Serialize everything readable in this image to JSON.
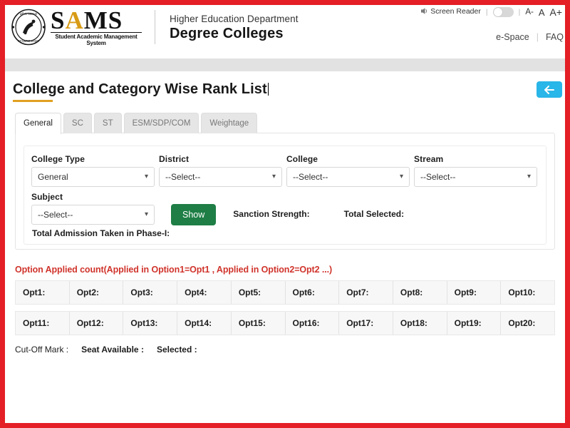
{
  "header": {
    "brand_name": "SAMS",
    "brand_letter_a": "A",
    "brand_subtitle": "Student Academic Management System",
    "dept_small": "Higher Education Department",
    "dept_big": "Degree Colleges",
    "utility": {
      "screen_reader_label": "Screen Reader",
      "font_decrease": "A-",
      "font_normal": "A",
      "font_increase": "A+",
      "separator": "|"
    },
    "nav_links": [
      "e-Space",
      "FAQ"
    ]
  },
  "page": {
    "title": "College and Category Wise Rank List",
    "back_button_icon": "arrow-left-icon"
  },
  "tabs": [
    {
      "label": "General",
      "active": true
    },
    {
      "label": "SC",
      "active": false
    },
    {
      "label": "ST",
      "active": false
    },
    {
      "label": "ESM/SDP/COM",
      "active": false
    },
    {
      "label": "Weightage",
      "active": false
    }
  ],
  "form": {
    "fields": [
      {
        "label": "College Type",
        "value": "General"
      },
      {
        "label": "District",
        "value": "--Select--"
      },
      {
        "label": "College",
        "value": "--Select--"
      },
      {
        "label": "Stream",
        "value": "--Select--"
      }
    ],
    "subject": {
      "label": "Subject",
      "value": "--Select--"
    },
    "show_button": "Show",
    "sanction_strength_label": "Sanction Strength:",
    "total_selected_label": "Total Selected:",
    "total_admission_label": "Total Admission Taken in Phase-I:"
  },
  "options": {
    "note": "Option Applied count(Applied in Option1=Opt1 , Applied in Option2=Opt2 ...)",
    "row1": [
      "Opt1:",
      "Opt2:",
      "Opt3:",
      "Opt4:",
      "Opt5:",
      "Opt6:",
      "Opt7:",
      "Opt8:",
      "Opt9:",
      "Opt10:"
    ],
    "row2": [
      "Opt11:",
      "Opt12:",
      "Opt13:",
      "Opt14:",
      "Opt15:",
      "Opt16:",
      "Opt17:",
      "Opt18:",
      "Opt19:",
      "Opt20:"
    ]
  },
  "footer": {
    "cutoff_label": "Cut-Off Mark :",
    "seat_available_label": "Seat Available :",
    "selected_label": "Selected :"
  },
  "colors": {
    "frame_red": "#e41f26",
    "accent_gold": "#e0a020",
    "show_green": "#1e7e45",
    "note_red": "#d0342c",
    "back_blue": "#29b6e8"
  }
}
